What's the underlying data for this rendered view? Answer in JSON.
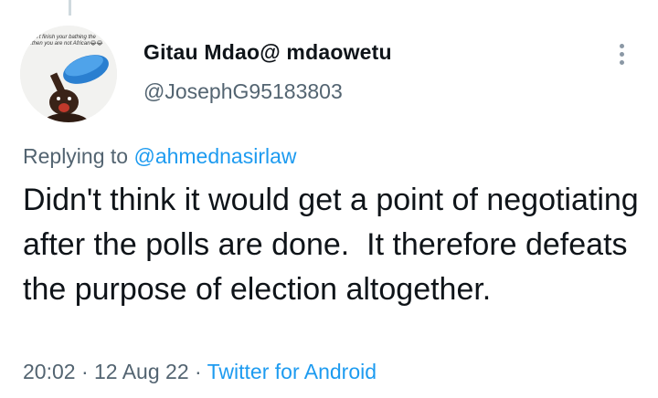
{
  "tweet": {
    "author": {
      "display_name": "Gitau Mdao@ mdaowetu",
      "handle": "@JosephG95183803",
      "avatar_caption": "...dn't finish your bathing the\n...then you are not African😂😂"
    },
    "replying_prefix": "Replying to ",
    "replying_to": "@ahmednasirlaw",
    "text": "Didn't think it would get a point of negotiating after the polls are done.  It therefore defeats the purpose of election altogether.",
    "time": "20:02",
    "separator1": " · ",
    "date": "12 Aug 22",
    "separator2": " · ",
    "source": "Twitter for Android",
    "more_icon": "more-vertical-icon"
  },
  "colors": {
    "primary_text": "#0f1419",
    "secondary_text": "#536471",
    "link": "#1d9bf0",
    "thread_line": "#cfd9de"
  }
}
